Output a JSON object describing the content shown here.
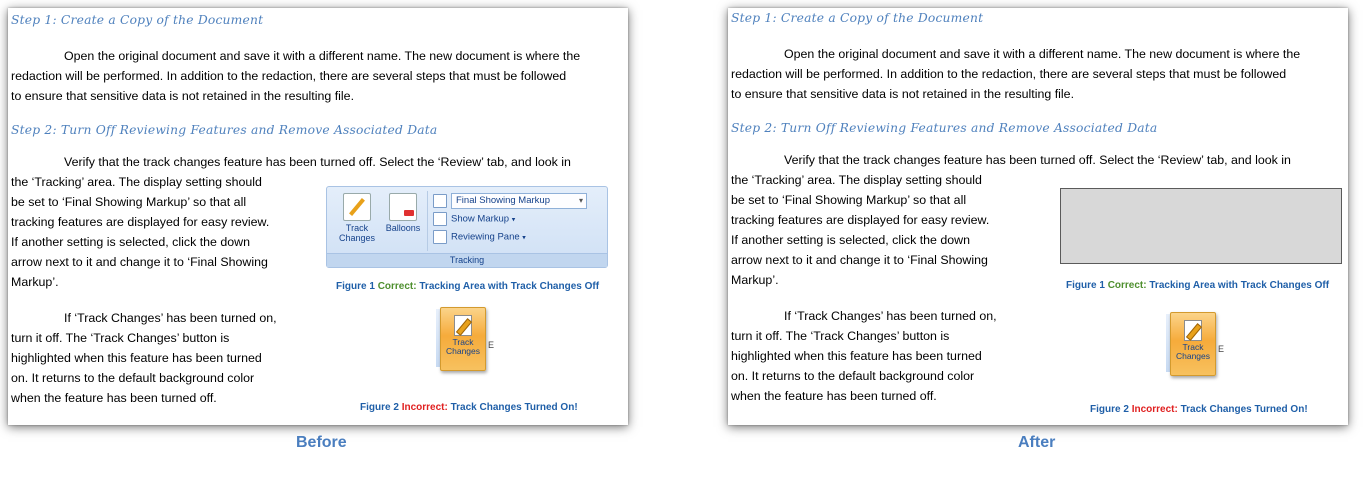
{
  "document": {
    "step1_heading": "Step 1: Create a Copy of the Document",
    "step1_lines": [
      "Open the original document and save it with a different name.  The new document is where the",
      "redaction will be performed.  In addition to the redaction, there are several steps that must be followed",
      "to ensure that sensitive data is not retained in the resulting file."
    ],
    "step2_heading": "Step 2: Turn Off Reviewing Features and Remove Associated Data",
    "step2_first_line": "Verify that the track changes feature has been turned off.  Select the ‘Review’ tab, and look in",
    "tracking_lines": [
      "the ‘Tracking’ area.  The display setting should",
      "be set to ‘Final Showing Markup’ so that all",
      "tracking features are displayed for easy review.",
      "If another setting is selected, click the down",
      "arrow next to it and change it to ‘Final Showing",
      "Markup’."
    ],
    "trackchanges_lines": [
      "If ‘Track Changes’ has been turned on,",
      "turn it off.  The ‘Track Changes’ button is",
      "highlighted when this feature has been turned",
      "on.  It returns to the default background color",
      "when the feature has been turned off."
    ],
    "after_trackchanges_lines": [
      "If ‘Track Changes’ has been turned on,",
      "turn it off.  The ‘Track Changes’ button is",
      "highlighted when this feature has been turned",
      "on.  It returns to the default background color",
      "when the feature has been turned off."
    ],
    "figure1": {
      "prefix": "Figure 1 ",
      "status": "Correct:",
      "text": " Tracking Area with Track Changes Off"
    },
    "figure2": {
      "prefix": "Figure 2 ",
      "status": "Incorrect:",
      "text": " Track Changes Turned On!"
    }
  },
  "ribbon": {
    "track_changes_label": "Track\nChanges",
    "balloons_label": "Balloons",
    "display_dropdown": "Final Showing Markup",
    "show_markup": "Show Markup",
    "reviewing_pane": "Reviewing Pane",
    "group_label": "Tracking"
  },
  "track_button": {
    "label_line1": "Track",
    "label_line2": "Changes",
    "side_letter": "E"
  },
  "labels": {
    "before": "Before",
    "after": "After"
  },
  "colors": {
    "heading": "#4f81bd",
    "correct": "#4e8f2e",
    "incorrect": "#e02020",
    "caption": "#1f5fa8",
    "label": "#4a7ebf"
  }
}
